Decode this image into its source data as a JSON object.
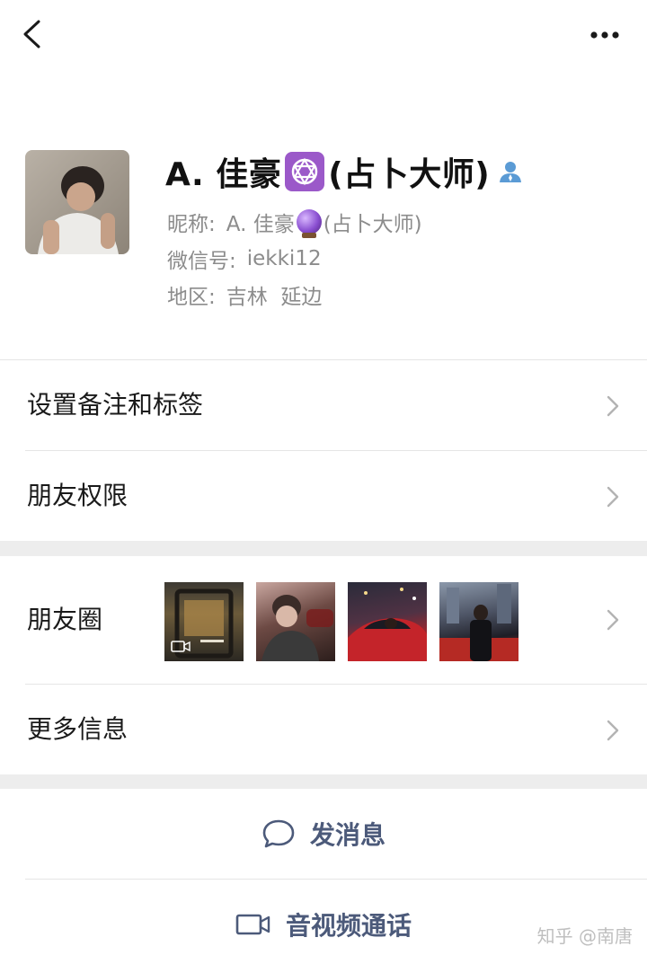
{
  "profile": {
    "name_prefix": "A. 佳豪",
    "name_emoji": "six-pointed-star-emoji",
    "name_suffix": "(占卜大师)",
    "nickname_label": "昵称:",
    "nickname_prefix": "A. 佳豪",
    "nickname_emoji": "crystal-ball-emoji",
    "nickname_suffix": "(占卜大师)",
    "wechat_id_label": "微信号:",
    "wechat_id": "iekki12",
    "region_label": "地区:",
    "region": "吉林  延边"
  },
  "menu": {
    "remark_tags": "设置备注和标签",
    "friend_permissions": "朋友权限",
    "moments": "朋友圈",
    "more_info": "更多信息"
  },
  "actions": {
    "send_message": "发消息",
    "video_call": "音视频通话"
  },
  "watermark": "知乎 @南唐",
  "colors": {
    "action_text": "#4c5a7a",
    "background": "#ededed",
    "card": "#ffffff",
    "secondary_text": "#8c8c8c"
  }
}
